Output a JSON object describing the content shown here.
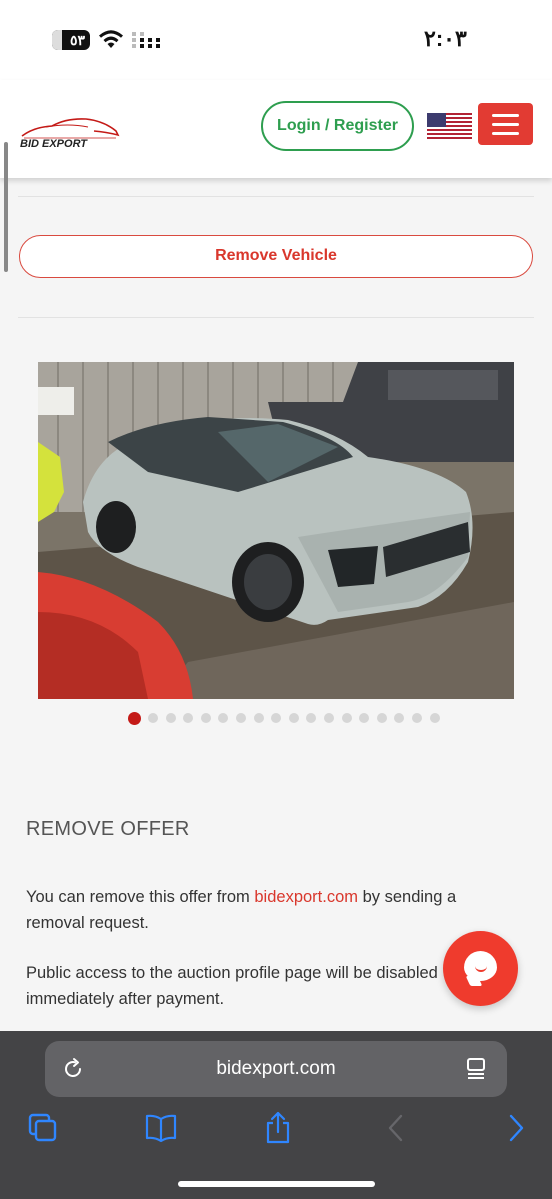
{
  "status_bar": {
    "time": "٢:٠٣",
    "battery_level": "٥٣"
  },
  "header": {
    "logo_text": "BID EXPORT",
    "login_label": "Login / Register",
    "flag_icon": "us-flag-icon",
    "menu_icon": "hamburger-menu-icon"
  },
  "main": {
    "remove_vehicle_label": "Remove Vehicle",
    "gallery": {
      "total_photos": 18,
      "active_index": 0
    },
    "remove_offer": {
      "title": "REMOVE OFFER",
      "para1_prefix": "You can remove this offer from ",
      "para1_link": "bidexport.com",
      "para1_suffix": " by sending a removal request.",
      "para2": "Public access to the auction profile page will be disabled immediately after payment."
    }
  },
  "browser": {
    "url": "bidexport.com"
  },
  "colors": {
    "accent_red": "#e23b33",
    "accent_green": "#2e9e4f"
  }
}
